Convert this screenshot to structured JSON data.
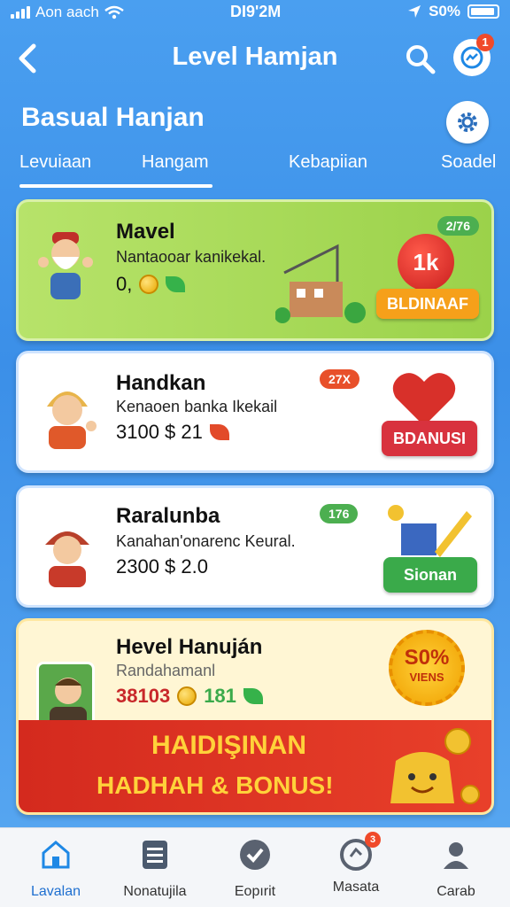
{
  "status": {
    "carrier": "Aon aach",
    "time": "DI9'2M",
    "battery": "S0%"
  },
  "header": {
    "title": "Level Hamjan",
    "message_badge": "1"
  },
  "section": {
    "title": "Basual Hanjan"
  },
  "tabs": [
    {
      "label": "Levuiaan"
    },
    {
      "label": "Hangam"
    },
    {
      "label": "Kebapiian"
    },
    {
      "label": "Soadel"
    }
  ],
  "cards": [
    {
      "title": "Mavel",
      "subtitle": "Nantaooar kanikekal.",
      "stats_value": "0,",
      "badge": "2/76",
      "button": "BLDINAAF",
      "emblem": "1k"
    },
    {
      "title": "Handkan",
      "subtitle": "Kenaoen banka Ikekail",
      "stats_value": "3100 $ 21",
      "badge": "27X",
      "button": "BDANUSI"
    },
    {
      "title": "Raralunba",
      "subtitle": "Kanahan'onarenc Keural.",
      "stats_value": "2300 $ 2.0",
      "badge": "176",
      "button": "Sionan"
    },
    {
      "title": "Hevel Hanuján",
      "subtitle": "Randahamanl",
      "stats_value": "38103",
      "stats_value2": "181",
      "seal_line1": "S0%",
      "seal_line2": "VIENS",
      "banner_line1": "HAIDIŞINAN",
      "banner_line2": "HADHAH & BONUS!"
    }
  ],
  "bottom_nav": [
    {
      "label": "Lavalan"
    },
    {
      "label": "Nonatujila"
    },
    {
      "label": "Eopırit"
    },
    {
      "label": "Masata",
      "badge": "3"
    },
    {
      "label": "Carab"
    }
  ]
}
